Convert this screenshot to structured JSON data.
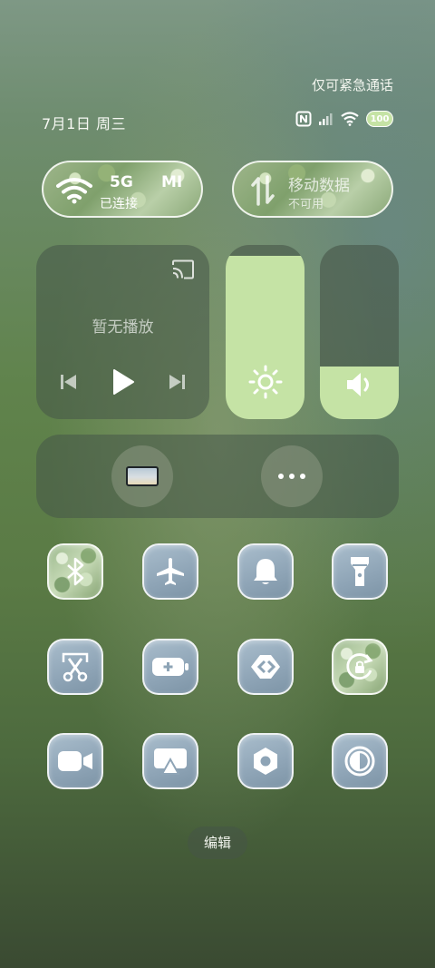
{
  "status_bar": {
    "emergency_text": "仅可紧急通话",
    "date": "7月1日 周三",
    "battery_level": "100",
    "icons": [
      "nfc-icon",
      "signal-icon",
      "wifi-icon",
      "battery-icon"
    ]
  },
  "wifi_card": {
    "band": "5G",
    "network_name": "MI",
    "status": "已连接",
    "icon": "wifi-icon"
  },
  "data_card": {
    "title": "移动数据",
    "status": "不可用",
    "icon": "mobile-data-icon"
  },
  "media": {
    "empty_text": "暂无播放",
    "icons": [
      "cast-icon",
      "previous-icon",
      "play-icon",
      "next-icon"
    ]
  },
  "sliders": {
    "brightness": {
      "level": 0.94,
      "icon": "sun-icon"
    },
    "volume": {
      "level": 0.3,
      "icon": "speaker-icon"
    }
  },
  "shortcuts": [
    "screen-thumbnail",
    "more-icon"
  ],
  "toggles": [
    {
      "name": "bluetooth-toggle",
      "icon": "bluetooth-icon"
    },
    {
      "name": "airplane-toggle",
      "icon": "airplane-icon"
    },
    {
      "name": "ring-toggle",
      "icon": "bell-icon"
    },
    {
      "name": "flashlight-toggle",
      "icon": "flashlight-icon"
    },
    {
      "name": "screenshot-toggle",
      "icon": "scissors-icon"
    },
    {
      "name": "battery-saver-toggle",
      "icon": "battery-plus-icon"
    },
    {
      "name": "link-toggle",
      "icon": "link-arrow-icon"
    },
    {
      "name": "rotation-lock-toggle",
      "icon": "rotation-lock-icon"
    },
    {
      "name": "video-toggle",
      "icon": "video-camera-icon"
    },
    {
      "name": "screen-cast-toggle",
      "icon": "screen-cast-icon"
    },
    {
      "name": "settings-toggle",
      "icon": "hexagon-settings-icon"
    },
    {
      "name": "dark-mode-toggle",
      "icon": "contrast-icon"
    }
  ],
  "edit_button": {
    "label": "编辑"
  },
  "colors": {
    "slider_fill": "#c5e3a5",
    "tile_bg": "#8ea4b6"
  }
}
